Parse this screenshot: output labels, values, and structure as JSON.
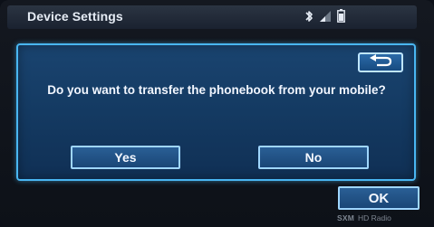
{
  "header": {
    "title": "Device Settings",
    "icons": [
      "bluetooth-icon",
      "signal-icon",
      "battery-icon"
    ]
  },
  "dialog": {
    "back_icon": "return-arrow-icon",
    "question": "Do you want to transfer the phonebook from your mobile?",
    "yes_label": "Yes",
    "no_label": "No"
  },
  "ok_label": "OK",
  "footer": {
    "brand_1": "SXM",
    "brand_2": "HD Radio"
  },
  "colors": {
    "dialog_border": "#49b6f2",
    "dialog_bg": "#143a62",
    "button_border": "#9fd6ff",
    "header_bg": "#222b38"
  }
}
